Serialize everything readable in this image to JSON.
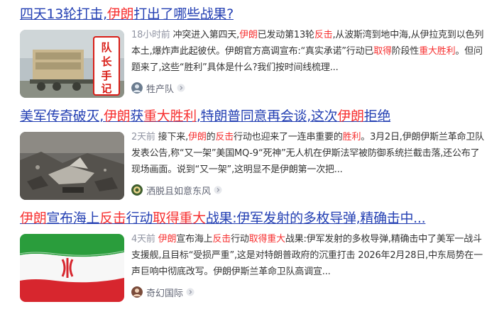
{
  "results": [
    {
      "title": [
        "四天13轮打击,",
        "伊朗",
        "打出了哪些战果?"
      ],
      "title_hl": [
        false,
        true,
        false
      ],
      "time": "18小时前",
      "abstract": [
        "冲突进入第四天,",
        "伊朗",
        "已发动第13轮",
        "反击",
        ",从波斯湾到地中海,从伊拉克到以色列本土,爆炸声此起彼伏。伊朗官方高调宣布:“真实承诺”行动已",
        "取得",
        "阶段性",
        "重大胜利",
        "。但问题来了,这些“胜利”具体是什么?我们按时间线梳理..."
      ],
      "abstract_hl": [
        false,
        true,
        false,
        true,
        false,
        true,
        false,
        true,
        false
      ],
      "thumb_text": [
        "队",
        "长",
        "手",
        "记"
      ],
      "source": "牲产队"
    },
    {
      "title": [
        "美军传奇破灭,",
        "伊朗",
        "获",
        "重大胜利",
        ",特朗普同意再会谈,这次",
        "伊朗",
        "拒绝"
      ],
      "title_hl": [
        false,
        true,
        false,
        true,
        false,
        true,
        false
      ],
      "time": "2天前",
      "abstract": [
        "接下来,",
        "伊朗",
        "的",
        "反击",
        "行动也迎来了一连串重要的",
        "胜利",
        "。3月2日,伊朗伊斯兰革命卫队发表公告,称“又一架”美国MQ-9“死神”无人机在伊斯法罕被防御系统拦截击落,还公布了现场画面。说到“又一架”,这明显不是伊朗第一次把..."
      ],
      "abstract_hl": [
        false,
        true,
        false,
        true,
        false,
        true,
        false
      ],
      "source": "洒脱且如意东风"
    },
    {
      "title": [
        "伊朗",
        "宣布海上",
        "反击",
        "行动",
        "取得重大",
        "战果:伊军发射的多枚导弹,精确击中..."
      ],
      "title_hl": [
        true,
        false,
        true,
        false,
        true,
        false
      ],
      "time": "4天前",
      "abstract": [
        "伊朗",
        "宣布海上",
        "反击",
        "行动",
        "取得重大",
        "战果:伊军发射的多枚导弹,精确击中了美军一战斗支援舰,且目标“受损严重”,这是对特朗普政府的沉重打击 2026年2月28日,中东局势在一声巨响中彻底改写。伊朗伊斯兰革命卫队高调宣..."
      ],
      "abstract_hl": [
        true,
        false,
        true,
        false,
        true,
        false
      ],
      "source": "奇幻国际"
    }
  ]
}
